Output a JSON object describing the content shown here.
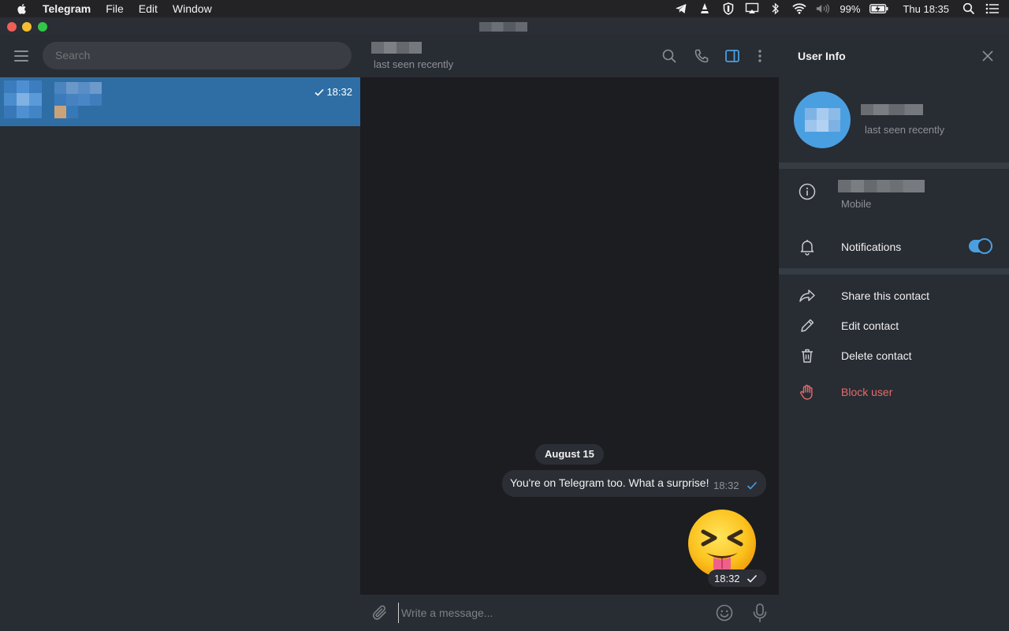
{
  "menubar": {
    "app_name": "Telegram",
    "items": [
      "File",
      "Edit",
      "Window"
    ],
    "battery": "99%",
    "clock": "Thu 18:35"
  },
  "sidebar": {
    "search_placeholder": "Search",
    "chats": [
      {
        "time": "18:32",
        "selected": true
      }
    ]
  },
  "chat": {
    "status": "last seen recently",
    "date_separator": "August 15",
    "messages": [
      {
        "text": "You're on Telegram too. What a surprise!",
        "time": "18:32"
      },
      {
        "sticker": "squinting-face-with-tongue",
        "time": "18:32"
      }
    ],
    "composer_placeholder": "Write a message..."
  },
  "user_info": {
    "title": "User Info",
    "status": "last seen recently",
    "phone_label": "Mobile",
    "notifications_label": "Notifications",
    "notifications_on": true,
    "actions": {
      "share": "Share this contact",
      "edit": "Edit contact",
      "delete": "Delete contact",
      "block": "Block user"
    }
  },
  "colors": {
    "accent": "#4a9fe0",
    "selected_chat": "#2f6ea5",
    "danger": "#e86a6a"
  }
}
